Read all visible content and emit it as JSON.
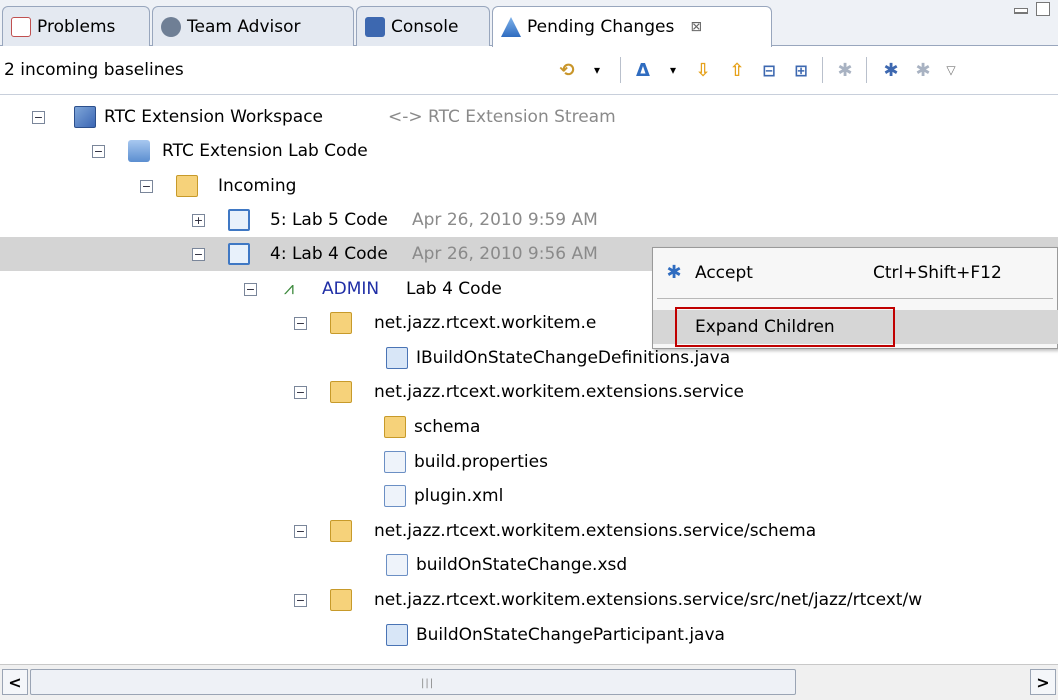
{
  "tabs": [
    {
      "label": "Problems",
      "icon": "problems-icon"
    },
    {
      "label": "Team Advisor",
      "icon": "gear-icon"
    },
    {
      "label": "Console",
      "icon": "console-icon"
    },
    {
      "label": "Pending Changes",
      "icon": "pending-changes-icon",
      "close": "⊠"
    }
  ],
  "toolbar": {
    "status": "2 incoming baselines"
  },
  "tree": [
    {
      "label": "RTC Extension Workspace",
      "suffix": "<-> RTC Extension Stream",
      "toggle": "−"
    },
    {
      "label": "RTC Extension Lab Code",
      "toggle": "−"
    },
    {
      "label": "Incoming",
      "toggle": "−"
    },
    {
      "label": "5: Lab 5 Code",
      "suffix": "Apr 26, 2010 9:59 AM",
      "toggle": "+"
    },
    {
      "label": "4: Lab 4 Code",
      "suffix": "Apr 26, 2010 9:56 AM",
      "toggle": "−"
    },
    {
      "author": "ADMIN",
      "label": "Lab 4 Code",
      "toggle": "−"
    },
    {
      "label": "net.jazz.rtcext.workitem.e",
      "toggle": "−"
    },
    {
      "label": "IBuildOnStateChangeDefinitions.java"
    },
    {
      "label": "net.jazz.rtcext.workitem.extensions.service",
      "toggle": "−"
    },
    {
      "label": "schema"
    },
    {
      "label": "build.properties"
    },
    {
      "label": "plugin.xml"
    },
    {
      "label": "net.jazz.rtcext.workitem.extensions.service/schema",
      "toggle": "−"
    },
    {
      "label": "buildOnStateChange.xsd"
    },
    {
      "label": "net.jazz.rtcext.workitem.extensions.service/src/net/jazz/rtcext/w",
      "toggle": "−"
    },
    {
      "label": "BuildOnStateChangeParticipant.java"
    }
  ],
  "context_menu": {
    "accept_label": "Accept",
    "accept_shortcut": "Ctrl+Shift+F12",
    "expand_label": "Expand Children"
  },
  "colors": {
    "selection": "#d4d4d4",
    "highlight_border": "#c00000",
    "author": "#1f2ea6"
  }
}
